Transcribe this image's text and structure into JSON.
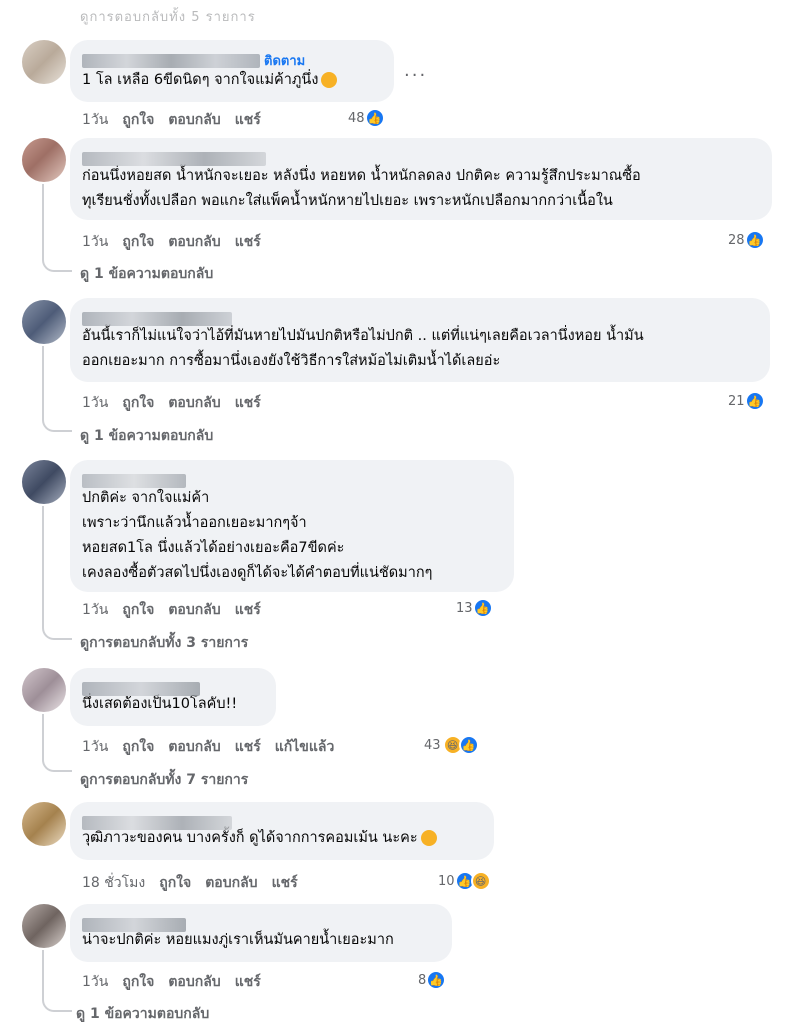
{
  "top_cut_text": "ดูการตอบกลับทั้ง 5 รายการ",
  "bottom_cut_text": "ดู 1 ข้อความตอบกลับ",
  "actions": {
    "like": "ถูกใจ",
    "reply": "ตอบกลับ",
    "share": "แชร์",
    "edited": "แก้ไขแล้ว"
  },
  "comments": [
    {
      "follow_label": "ติดตาม",
      "text": "1 โล เหลือ 6ขีดนิดๆ จากใจแม่ค้าภูนึ่ง",
      "time": "1วัน",
      "reaction_count": "48",
      "more_label": "..."
    },
    {
      "text": "ก่อนนึ่งหอยสด น้ำหนักจะเยอะ หลังนึ่ง หอยหด น้ำหนักลดลง ปกติคะ ความรู้สึกประมาณซื้อ\nทุเรียนชั่งทั้งเปลือก พอแกะใส่แพ็คน้ำหนักหายไปเยอะ เพราะหนักเปลือกมากกว่าเนื้อใน",
      "time": "1วัน",
      "reaction_count": "28",
      "replies_label": "ดู 1 ข้อความตอบกลับ"
    },
    {
      "text": "อันนี้เราก็ไม่แน่ใจว่าไอ้ที่มันหายไปมันปกติหรือไม่ปกติ .. แต่ที่แน่ๆเลยคือเวลานึ่งหอย น้ำมัน\nออกเยอะมาก การซื้อมานึ่งเองยังใช้วิธีการใส่หม้อไม่เติมน้ำได้เลยอ่ะ",
      "time": "1วัน",
      "reaction_count": "21",
      "replies_label": "ดู 1 ข้อความตอบกลับ"
    },
    {
      "text": "ปกติค่ะ จากใจแม่ค้า\nเพราะว่านึกแล้วน้ำออกเยอะมากๆจ้า\nหอยสด1โล นึ่งแล้วได้อย่างเยอะคือ7ขีดค่ะ\nเคงลองซื้อตัวสดไปนึ่งเองดูก็ได้จะได้คำตอบที่แน่ชัดมากๆ",
      "time": "1วัน",
      "reaction_count": "13",
      "replies_label": "ดูการตอบกลับทั้ง 3 รายการ"
    },
    {
      "text": "นึ่งเสดต้องเป็น10โลคับ!!",
      "time": "1วัน",
      "reaction_count": "43",
      "replies_label": "ดูการตอบกลับทั้ง 7 รายการ"
    },
    {
      "text": "วุฒิภาวะของคน บางครั้งก็ ดูได้จากการคอมเม้น นะคะ",
      "time": "18 ชั่วโมง",
      "reaction_count": "10"
    },
    {
      "text": "น่าจะปกติค่ะ หอยแมงภู่เราเห็นมันคายน้ำเยอะมาก",
      "time": "1วัน",
      "reaction_count": "8"
    }
  ],
  "colors": {
    "bubble": "#f0f2f5",
    "link": "#1877f2",
    "meta": "#65676b",
    "text": "#050505"
  },
  "icons": [
    "like-icon",
    "haha-icon",
    "smile-icon",
    "more-icon"
  ]
}
